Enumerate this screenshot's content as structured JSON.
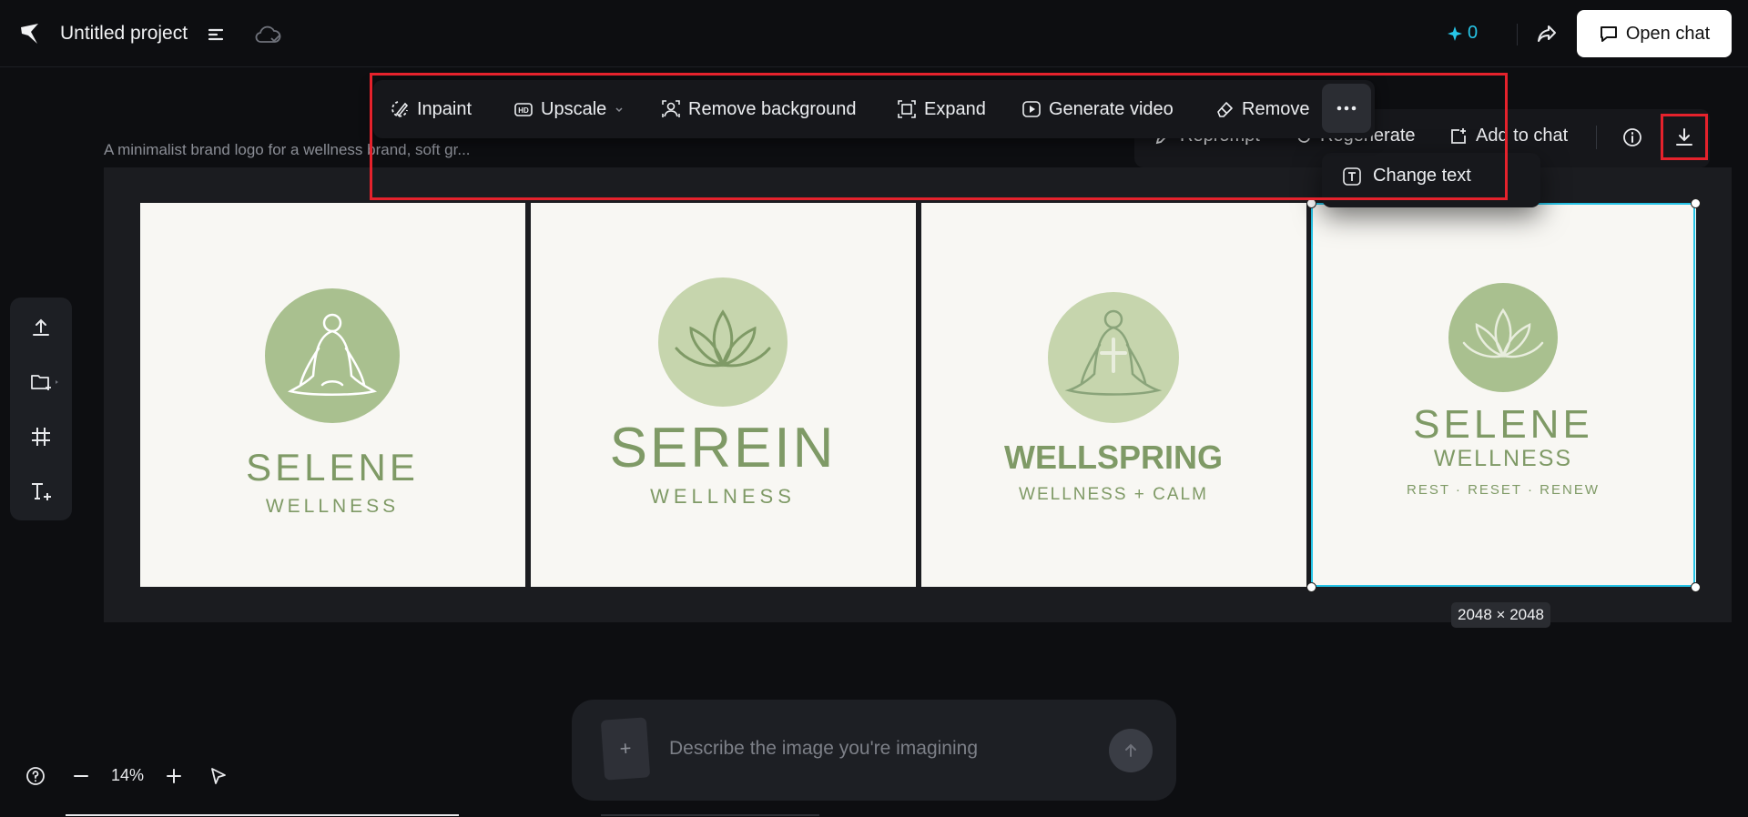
{
  "header": {
    "project_title": "Untitled project",
    "credits": "0",
    "open_chat_label": "Open chat"
  },
  "prompt_caption": "A minimalist brand logo for a wellness brand, soft gr...",
  "toolbar": {
    "inpaint": "Inpaint",
    "upscale": "Upscale",
    "remove_background": "Remove background",
    "expand": "Expand",
    "generate_video": "Generate video",
    "remove": "Remove"
  },
  "actionbar": {
    "reprompt": "Reprompt",
    "regenerate": "Regenerate",
    "add_to_chat": "Add to chat"
  },
  "dropdown": {
    "change_text": "Change text"
  },
  "images": [
    {
      "brand": "SELENE",
      "sub": "WELLNESS",
      "tagline": ""
    },
    {
      "brand": "SEREIN",
      "sub": "WELLNESS",
      "tagline": ""
    },
    {
      "brand": "WELLSPRING",
      "sub": "WELLNESS + CALM",
      "tagline": ""
    },
    {
      "brand": "SELENE",
      "sub": "WELLNESS",
      "tagline": "REST · RESET · RENEW"
    }
  ],
  "selection": {
    "dimensions": "2048 × 2048"
  },
  "chat": {
    "attach_symbol": "+",
    "placeholder": "Describe the image you're imagining"
  },
  "zoom": {
    "level": "14%"
  },
  "colors": {
    "accent": "#25c3e6",
    "annotation_red": "#e5222c",
    "logo_green": "#a9c08f",
    "logo_text_green": "#7f9a66",
    "background": "#0d0e11"
  }
}
